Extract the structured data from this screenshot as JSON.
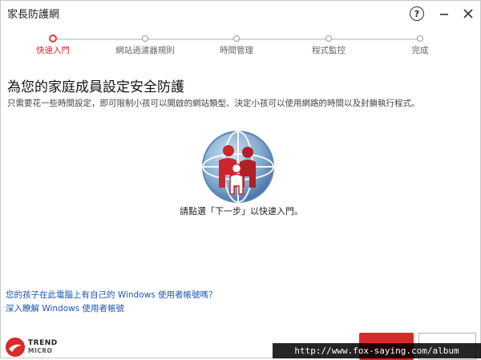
{
  "window": {
    "title": "家長防護網",
    "help_icon": "question-circle-icon",
    "help_label": "?",
    "minimize_icon": "minimize-icon",
    "close_icon": "close-icon"
  },
  "stepper": {
    "steps": [
      {
        "label": "快速入門",
        "active": true
      },
      {
        "label": "網站過濾器規則",
        "active": false
      },
      {
        "label": "時間管理",
        "active": false
      },
      {
        "label": "程式監控",
        "active": false
      },
      {
        "label": "完成",
        "active": false
      }
    ],
    "accent_color": "#e23b3b"
  },
  "main": {
    "heading": "為您的家庭成員設定安全防護",
    "subtext": "只需要花一些時間設定，即可限制小孩可以開啟的網站類型、決定小孩可以使用網路的時間以及封鎖執行程式。",
    "illustration_icon": "family-globe-icon",
    "prompt": "請點選「下一步」以快速入門。"
  },
  "links": {
    "own_account": "您的孩子在此電腦上有自己的 Windows 使用者帳號嗎？",
    "learn_more": "深入瞭解 Windows 使用者帳號"
  },
  "brand": {
    "logo_icon": "trend-micro-logo-icon",
    "line1": "TREND",
    "line2": "MICRO"
  },
  "footer": {
    "next_color": "#d9292b",
    "watermark": "http://www.fox-saying.com/album"
  }
}
